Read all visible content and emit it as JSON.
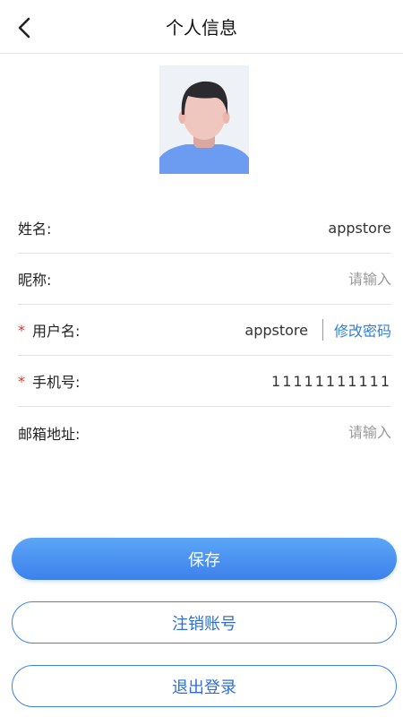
{
  "header": {
    "title": "个人信息",
    "back_icon": "chevron-left-icon"
  },
  "profile": {
    "avatar_icon": "person-avatar-icon"
  },
  "form": {
    "name": {
      "label": "姓名:",
      "value": "appstore",
      "required": false
    },
    "nickname": {
      "label": "昵称:",
      "placeholder": "请输入",
      "value": "",
      "required": false
    },
    "username": {
      "label": "用户名:",
      "value": "appstore",
      "required": true,
      "required_mark": "*",
      "change_password_label": "修改密码"
    },
    "phone": {
      "label": "手机号:",
      "value": "11111111111",
      "required": true,
      "required_mark": "*"
    },
    "email": {
      "label": "邮箱地址:",
      "placeholder": "请输入",
      "value": "",
      "required": false
    }
  },
  "actions": {
    "save_label": "保存",
    "deactivate_label": "注销账号",
    "logout_label": "退出登录"
  },
  "colors": {
    "accent": "#3d80ec",
    "link": "#2f7fd8",
    "required": "#d9342b",
    "placeholder": "#999999"
  }
}
